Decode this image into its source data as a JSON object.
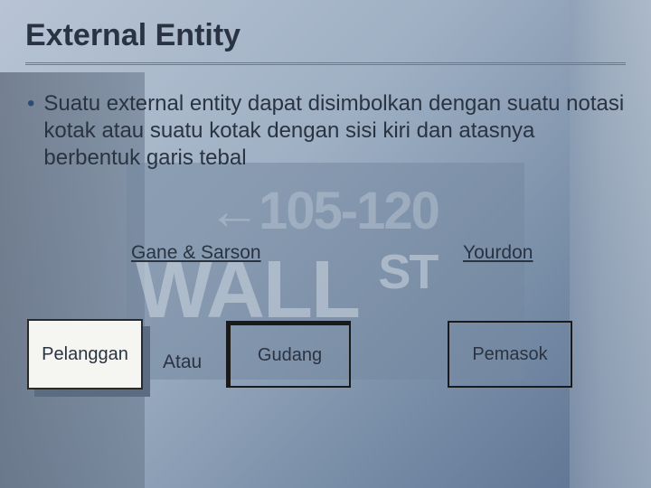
{
  "title": "External Entity",
  "bullet": "Suatu external entity dapat disimbolkan dengan suatu notasi kotak atau suatu kotak dengan sisi kiri dan atasnya berbentuk garis tebal",
  "notation_labels": {
    "gane_sarson": "Gane & Sarson",
    "yourdon": "Yourdon"
  },
  "boxes": {
    "pelanggan": "Pelanggan",
    "atau": "Atau",
    "gudang": "Gudang",
    "pemasok": "Pemasok"
  },
  "bg": {
    "line1": "←105-120",
    "line2_a": "WALL",
    "line2_b": "ST"
  }
}
